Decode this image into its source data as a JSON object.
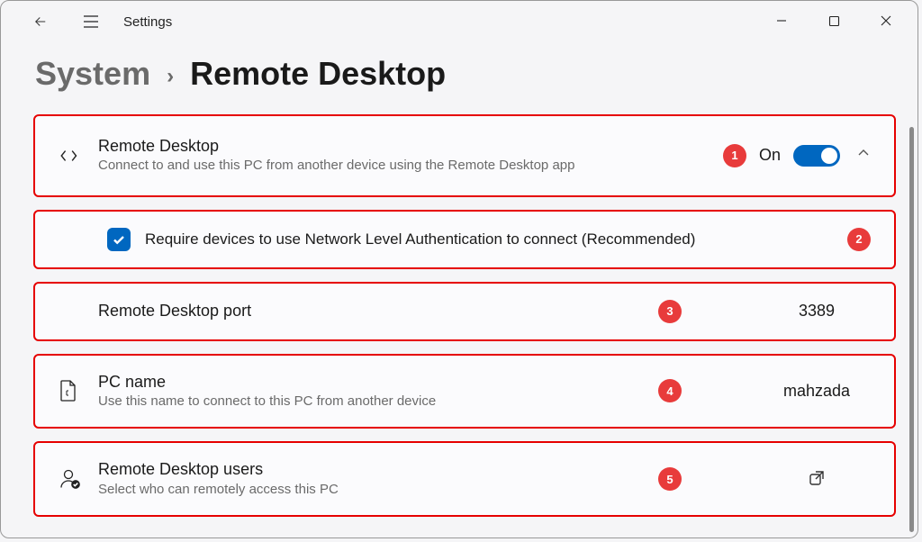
{
  "app": {
    "title": "Settings"
  },
  "breadcrumb": {
    "parent": "System",
    "current": "Remote Desktop"
  },
  "rows": {
    "remote": {
      "title": "Remote Desktop",
      "sub": "Connect to and use this PC from another device using the Remote Desktop app",
      "toggle_label": "On",
      "badge": "1"
    },
    "nla": {
      "label": "Require devices to use Network Level Authentication to connect (Recommended)",
      "badge": "2"
    },
    "port": {
      "title": "Remote Desktop port",
      "value": "3389",
      "badge": "3"
    },
    "pcname": {
      "title": "PC name",
      "sub": "Use this name to connect to this PC from another device",
      "value": "mahzada",
      "badge": "4"
    },
    "users": {
      "title": "Remote Desktop users",
      "sub": "Select who can remotely access this PC",
      "badge": "5"
    }
  }
}
